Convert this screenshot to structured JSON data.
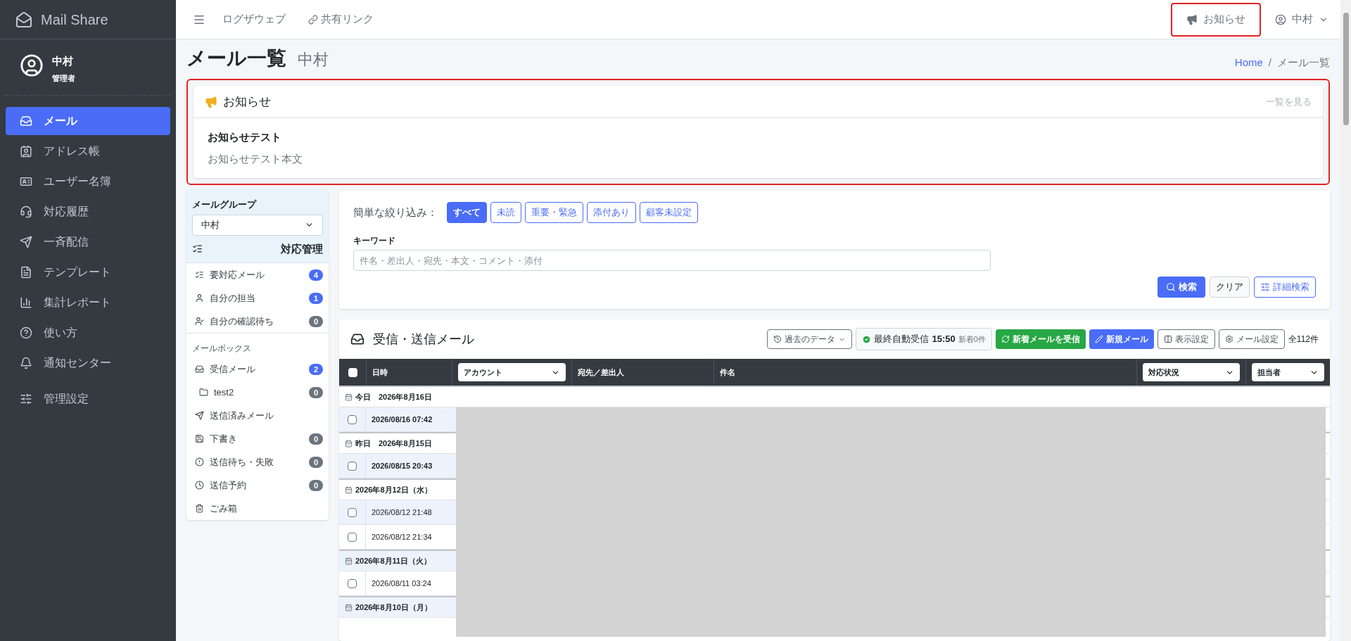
{
  "brand": "Mail Share",
  "user": {
    "name": "中村",
    "role": "管理者"
  },
  "sidebar": {
    "items": [
      {
        "label": "メール",
        "selected": true
      },
      {
        "label": "アドレス帳",
        "selected": false
      },
      {
        "label": "ユーザー名簿",
        "selected": false
      },
      {
        "label": "対応履歴",
        "selected": false
      },
      {
        "label": "一斉配信",
        "selected": false
      },
      {
        "label": "テンプレート",
        "selected": false
      },
      {
        "label": "集計レポート",
        "selected": false
      },
      {
        "label": "使い方",
        "selected": false
      },
      {
        "label": "通知センター",
        "selected": false
      },
      {
        "label": "管理設定",
        "selected": false
      }
    ]
  },
  "topbar": {
    "links": [
      "ログザウェブ",
      "共有リンク"
    ],
    "notice_button": "お知らせ",
    "user_menu": "中村"
  },
  "page": {
    "title": "メール一覧",
    "subtitle": "中村",
    "breadcrumb": [
      "Home",
      "/",
      "メール一覧"
    ]
  },
  "notice": {
    "title": "お知らせ",
    "view_all": "一覧を見る",
    "item_title": "お知らせテスト",
    "item_body": "お知らせテスト本文"
  },
  "left_panel": {
    "group_label": "メールグループ",
    "group_value": "中村",
    "section_title": "対応管理",
    "items": [
      {
        "kind": "item",
        "label": "要対応メール",
        "badge": {
          "text": "4",
          "color": "#4a6cf7"
        }
      },
      {
        "kind": "item",
        "label": "自分の担当",
        "badge": {
          "text": "1",
          "color": "#4a6cf7"
        }
      },
      {
        "kind": "item",
        "label": "自分の確認待ち",
        "badge": {
          "text": "0",
          "color": "#6c757d"
        }
      },
      {
        "kind": "header",
        "label": "メールボックス"
      },
      {
        "kind": "item",
        "label": "受信メール",
        "badge": {
          "text": "2",
          "color": "#4a6cf7"
        }
      },
      {
        "kind": "subitem",
        "label": "test2",
        "badge": {
          "text": "0",
          "color": "#6c757d"
        }
      },
      {
        "kind": "item",
        "label": "送信済みメール"
      },
      {
        "kind": "item",
        "label": "下書き",
        "badge": {
          "text": "0",
          "color": "#6c757d"
        }
      },
      {
        "kind": "item",
        "label": "送信待ち・失敗",
        "badge": {
          "text": "0",
          "color": "#6c757d"
        }
      },
      {
        "kind": "item",
        "label": "送信予約",
        "badge": {
          "text": "0",
          "color": "#6c757d"
        }
      },
      {
        "kind": "item",
        "label": "ごみ箱"
      }
    ]
  },
  "filter": {
    "label": "簡単な絞り込み：",
    "chips": [
      {
        "label": "すべて",
        "selected": true
      },
      {
        "label": "未読",
        "selected": false
      },
      {
        "label": "重要・緊急",
        "selected": false
      },
      {
        "label": "添付あり",
        "selected": false
      },
      {
        "label": "顧客未設定",
        "selected": false
      }
    ],
    "keyword_label": "キーワード",
    "keyword_placeholder": "件名・差出人・宛先・本文・コメント・添付",
    "search_button": "検索",
    "clear_button": "クリア",
    "advanced_button": "詳細検索"
  },
  "mail": {
    "title": "受信・送信メール",
    "past_data": "過去のデータ",
    "auto_label": "最終自動受信",
    "auto_time": "15:50",
    "auto_new": "新着0件",
    "receive_button": "新着メールを受信",
    "new_button": "新規メール",
    "display_button": "表示設定",
    "settings_button": "メール設定",
    "total": "全112件",
    "select_all_checked": false,
    "columns": {
      "date": "日時",
      "account": "アカウント",
      "address": "宛先／差出人",
      "subject": "件名",
      "status": "対応状況",
      "assignee": "担当者"
    },
    "rows": [
      {
        "kind": "group",
        "label": "今日　2026年8月16日",
        "shaded": false
      },
      {
        "kind": "mail",
        "date": "2026/08/16 07:42",
        "unread": true,
        "checked": false,
        "shaded": true
      },
      {
        "kind": "group",
        "label": "昨日　2026年8月15日",
        "shaded": false
      },
      {
        "kind": "mail",
        "date": "2026/08/15 20:43",
        "unread": true,
        "checked": false,
        "shaded": true
      },
      {
        "kind": "group",
        "label": "2026年8月12日（水）",
        "shaded": false
      },
      {
        "kind": "mail",
        "date": "2026/08/12 21:48",
        "unread": false,
        "checked": false,
        "shaded": true
      },
      {
        "kind": "mail",
        "date": "2026/08/12 21:34",
        "unread": false,
        "checked": false,
        "shaded": false
      },
      {
        "kind": "group",
        "label": "2026年8月11日（火）",
        "shaded": true
      },
      {
        "kind": "mail",
        "date": "2026/08/11 03:24",
        "unread": false,
        "checked": false,
        "shaded": false
      },
      {
        "kind": "group",
        "label": "2026年8月10日（月）",
        "shaded": true
      }
    ]
  }
}
